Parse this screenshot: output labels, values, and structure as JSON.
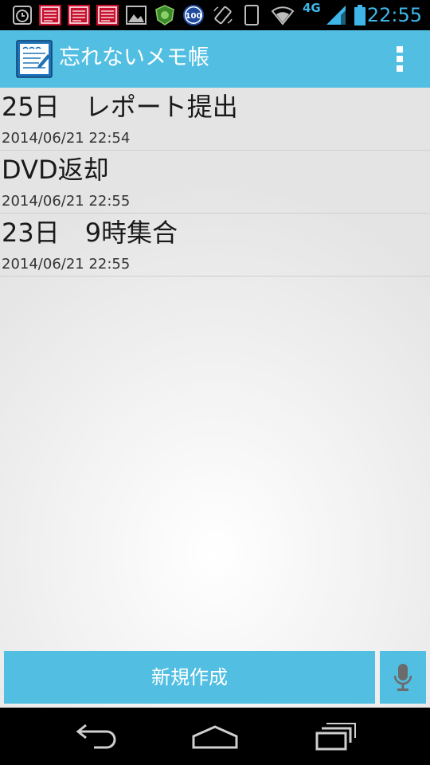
{
  "status_bar": {
    "time": "22:55",
    "network": "4G",
    "notification_badge": "100",
    "icons": [
      "alarm-icon",
      "calendar-icon",
      "calendar-icon",
      "calendar-icon",
      "image-icon",
      "shield-app-icon",
      "battery-100-badge-icon",
      "screen-rotation-icon",
      "phone-icon",
      "wifi-icon",
      "signal-icon",
      "battery-icon"
    ]
  },
  "action_bar": {
    "title": "忘れないメモ帳",
    "icon": "memo-app-icon",
    "overflow_icon": "overflow-menu-icon"
  },
  "memos": [
    {
      "title": "25日　レポート提出",
      "date": "2014/06/21 22:54"
    },
    {
      "title": "DVD返却",
      "date": "2014/06/21 22:55"
    },
    {
      "title": "23日　9時集合",
      "date": "2014/06/21 22:55"
    }
  ],
  "actions": {
    "new_label": "新規作成",
    "mic_icon": "microphone-icon"
  },
  "nav_bar": {
    "icons": [
      "back-icon",
      "home-icon",
      "recent-apps-icon"
    ]
  },
  "colors": {
    "accent": "#52bfe2",
    "status_text": "#3fb6e8",
    "list_text": "#1a1a1a"
  }
}
